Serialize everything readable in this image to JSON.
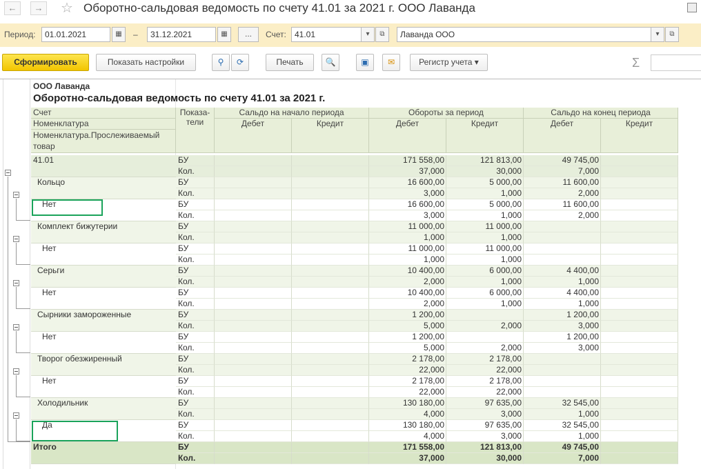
{
  "window": {
    "title": "Оборотно-сальдовая ведомость по счету 41.01 за 2021 г. ООО Лаванда",
    "back_glyph": "←",
    "forward_glyph": "→",
    "star_glyph": "☆"
  },
  "params": {
    "period_label": "Период:",
    "date_from": "01.01.2021",
    "dash": "–",
    "date_to": "31.12.2021",
    "ellipsis": "...",
    "account_label": "Счет:",
    "account": "41.01",
    "organization": "Лаванда ООО"
  },
  "toolbar": {
    "generate": "Сформировать",
    "show_settings": "Показать настройки",
    "print": "Печать",
    "register": "Регистр учета",
    "sigma": "Σ"
  },
  "report": {
    "org": "ООО Лаванда",
    "title": "Оборотно-сальдовая ведомость по счету 41.01 за 2021 г.",
    "headers": {
      "account": "Счет",
      "nomenclature": "Номенклатура",
      "traceable": "Номенклатура.Прослеживаемый товар",
      "indicators": "Показа-\nтели",
      "opening": "Сальдо на начало периода",
      "turnover": "Обороты за период",
      "closing": "Сальдо на конец периода",
      "debit": "Дебет",
      "credit": "Кредит"
    },
    "rows": [
      {
        "label": "41.01",
        "level": 0,
        "ind": "БУ",
        "od": "",
        "oc": "",
        "td": "171 558,00",
        "tc": "121 813,00",
        "cd": "49 745,00",
        "cc": ""
      },
      {
        "label": "",
        "level": 0,
        "ind": "Кол.",
        "od": "",
        "oc": "",
        "td": "37,000",
        "tc": "30,000",
        "cd": "7,000",
        "cc": ""
      },
      {
        "label": "Кольцо",
        "level": 1,
        "ind": "БУ",
        "od": "",
        "oc": "",
        "td": "16 600,00",
        "tc": "5 000,00",
        "cd": "11 600,00",
        "cc": ""
      },
      {
        "label": "",
        "level": 1,
        "ind": "Кол.",
        "od": "",
        "oc": "",
        "td": "3,000",
        "tc": "1,000",
        "cd": "2,000",
        "cc": ""
      },
      {
        "label": "Нет",
        "level": 2,
        "ind": "БУ",
        "od": "",
        "oc": "",
        "td": "16 600,00",
        "tc": "5 000,00",
        "cd": "11 600,00",
        "cc": ""
      },
      {
        "label": "",
        "level": 2,
        "ind": "Кол.",
        "od": "",
        "oc": "",
        "td": "3,000",
        "tc": "1,000",
        "cd": "2,000",
        "cc": ""
      },
      {
        "label": "Комплект бижутерии",
        "level": 1,
        "ind": "БУ",
        "od": "",
        "oc": "",
        "td": "11 000,00",
        "tc": "11 000,00",
        "cd": "",
        "cc": ""
      },
      {
        "label": "",
        "level": 1,
        "ind": "Кол.",
        "od": "",
        "oc": "",
        "td": "1,000",
        "tc": "1,000",
        "cd": "",
        "cc": ""
      },
      {
        "label": "Нет",
        "level": 2,
        "ind": "БУ",
        "od": "",
        "oc": "",
        "td": "11 000,00",
        "tc": "11 000,00",
        "cd": "",
        "cc": ""
      },
      {
        "label": "",
        "level": 2,
        "ind": "Кол.",
        "od": "",
        "oc": "",
        "td": "1,000",
        "tc": "1,000",
        "cd": "",
        "cc": ""
      },
      {
        "label": "Серьги",
        "level": 1,
        "ind": "БУ",
        "od": "",
        "oc": "",
        "td": "10 400,00",
        "tc": "6 000,00",
        "cd": "4 400,00",
        "cc": ""
      },
      {
        "label": "",
        "level": 1,
        "ind": "Кол.",
        "od": "",
        "oc": "",
        "td": "2,000",
        "tc": "1,000",
        "cd": "1,000",
        "cc": ""
      },
      {
        "label": "Нет",
        "level": 2,
        "ind": "БУ",
        "od": "",
        "oc": "",
        "td": "10 400,00",
        "tc": "6 000,00",
        "cd": "4 400,00",
        "cc": ""
      },
      {
        "label": "",
        "level": 2,
        "ind": "Кол.",
        "od": "",
        "oc": "",
        "td": "2,000",
        "tc": "1,000",
        "cd": "1,000",
        "cc": ""
      },
      {
        "label": "Сырники замороженные",
        "level": 1,
        "ind": "БУ",
        "od": "",
        "oc": "",
        "td": "1 200,00",
        "tc": "",
        "cd": "1 200,00",
        "cc": ""
      },
      {
        "label": "",
        "level": 1,
        "ind": "Кол.",
        "od": "",
        "oc": "",
        "td": "5,000",
        "tc": "2,000",
        "cd": "3,000",
        "cc": ""
      },
      {
        "label": "Нет",
        "level": 2,
        "ind": "БУ",
        "od": "",
        "oc": "",
        "td": "1 200,00",
        "tc": "",
        "cd": "1 200,00",
        "cc": ""
      },
      {
        "label": "",
        "level": 2,
        "ind": "Кол.",
        "od": "",
        "oc": "",
        "td": "5,000",
        "tc": "2,000",
        "cd": "3,000",
        "cc": ""
      },
      {
        "label": "Творог обезжиренный",
        "level": 1,
        "ind": "БУ",
        "od": "",
        "oc": "",
        "td": "2 178,00",
        "tc": "2 178,00",
        "cd": "",
        "cc": ""
      },
      {
        "label": "",
        "level": 1,
        "ind": "Кол.",
        "od": "",
        "oc": "",
        "td": "22,000",
        "tc": "22,000",
        "cd": "",
        "cc": ""
      },
      {
        "label": "Нет",
        "level": 2,
        "ind": "БУ",
        "od": "",
        "oc": "",
        "td": "2 178,00",
        "tc": "2 178,00",
        "cd": "",
        "cc": ""
      },
      {
        "label": "",
        "level": 2,
        "ind": "Кол.",
        "od": "",
        "oc": "",
        "td": "22,000",
        "tc": "22,000",
        "cd": "",
        "cc": ""
      },
      {
        "label": "Холодильник",
        "level": 1,
        "ind": "БУ",
        "od": "",
        "oc": "",
        "td": "130 180,00",
        "tc": "97 635,00",
        "cd": "32 545,00",
        "cc": ""
      },
      {
        "label": "",
        "level": 1,
        "ind": "Кол.",
        "od": "",
        "oc": "",
        "td": "4,000",
        "tc": "3,000",
        "cd": "1,000",
        "cc": ""
      },
      {
        "label": "Да",
        "level": 2,
        "ind": "БУ",
        "od": "",
        "oc": "",
        "td": "130 180,00",
        "tc": "97 635,00",
        "cd": "32 545,00",
        "cc": ""
      },
      {
        "label": "",
        "level": 2,
        "ind": "Кол.",
        "od": "",
        "oc": "",
        "td": "4,000",
        "tc": "3,000",
        "cd": "1,000",
        "cc": ""
      },
      {
        "label": "Итого",
        "level": 3,
        "ind": "БУ",
        "od": "",
        "oc": "",
        "td": "171 558,00",
        "tc": "121 813,00",
        "cd": "49 745,00",
        "cc": ""
      },
      {
        "label": "",
        "level": 3,
        "ind": "Кол.",
        "od": "",
        "oc": "",
        "td": "37,000",
        "tc": "30,000",
        "cd": "7,000",
        "cc": ""
      }
    ]
  },
  "colors": {
    "header_bg": "#e8efd9",
    "level0_bg": "#e6eedb",
    "level1_bg": "#f0f5e8",
    "level2_bg": "#ffffff",
    "total_bg": "#d9e6c6",
    "highlight": "#1aa35a",
    "params_bg": "#fbeec6",
    "primary_btn": "#f5d11a"
  }
}
